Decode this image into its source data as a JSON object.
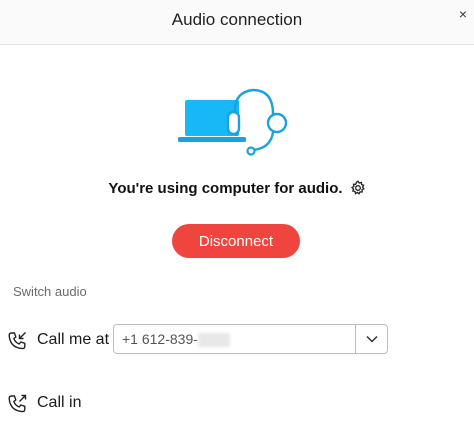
{
  "header": {
    "title": "Audio connection",
    "close_glyph": "×"
  },
  "illustration": {
    "icon": "laptop-headset-icon",
    "accent": "#17b8f5",
    "outline": "#1da1de"
  },
  "status": {
    "text": "You're using computer for audio.",
    "settings_icon": "gear-icon"
  },
  "disconnect": {
    "label": "Disconnect",
    "color": "#f0443e"
  },
  "switch_audio": {
    "label": "Switch audio",
    "options": [
      {
        "label": "Call me at",
        "icon": "phone-outgoing-icon",
        "phone_value": "+1 612-839-"
      },
      {
        "label": "Call in",
        "icon": "phone-incoming-icon"
      }
    ]
  }
}
